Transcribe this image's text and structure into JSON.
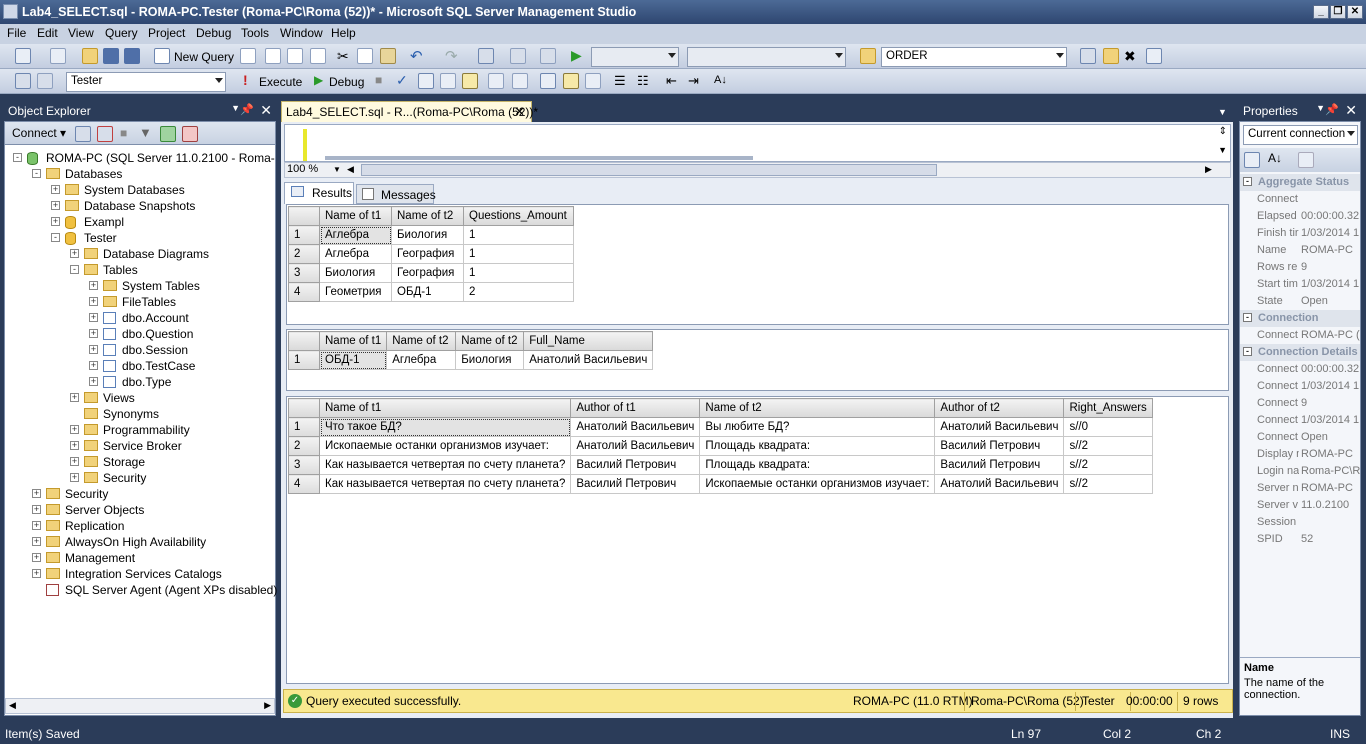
{
  "window": {
    "title": "Lab4_SELECT.sql - ROMA-PC.Tester (Roma-PC\\Roma (52))* - Microsoft SQL Server Management Studio"
  },
  "menu": [
    "File",
    "Edit",
    "View",
    "Query",
    "Project",
    "Debug",
    "Tools",
    "Window",
    "Help"
  ],
  "toolbar1": {
    "new_query": "New Query",
    "search_value": "ORDER"
  },
  "toolbar2": {
    "database": "Tester",
    "execute": "Execute",
    "debug": "Debug"
  },
  "object_explorer": {
    "title": "Object Explorer",
    "connect": "Connect",
    "tree": [
      {
        "label": "ROMA-PC (SQL Server 11.0.2100 - Roma-PC\\Roma)",
        "level": 0,
        "exp": "-",
        "icon": "server-icon"
      },
      {
        "label": "Databases",
        "level": 1,
        "exp": "-",
        "icon": "folder-icon"
      },
      {
        "label": "System Databases",
        "level": 2,
        "exp": "+",
        "icon": "folder-icon"
      },
      {
        "label": "Database Snapshots",
        "level": 2,
        "exp": "+",
        "icon": "folder-icon"
      },
      {
        "label": "Exampl",
        "level": 2,
        "exp": "+",
        "icon": "database-icon"
      },
      {
        "label": "Tester",
        "level": 2,
        "exp": "-",
        "icon": "database-icon"
      },
      {
        "label": "Database Diagrams",
        "level": 3,
        "exp": "+",
        "icon": "folder-icon"
      },
      {
        "label": "Tables",
        "level": 3,
        "exp": "-",
        "icon": "folder-icon"
      },
      {
        "label": "System Tables",
        "level": 4,
        "exp": "+",
        "icon": "folder-icon"
      },
      {
        "label": "FileTables",
        "level": 4,
        "exp": "+",
        "icon": "folder-icon"
      },
      {
        "label": "dbo.Account",
        "level": 4,
        "exp": "+",
        "icon": "table-icon"
      },
      {
        "label": "dbo.Question",
        "level": 4,
        "exp": "+",
        "icon": "table-icon"
      },
      {
        "label": "dbo.Session",
        "level": 4,
        "exp": "+",
        "icon": "table-icon"
      },
      {
        "label": "dbo.TestCase",
        "level": 4,
        "exp": "+",
        "icon": "table-icon"
      },
      {
        "label": "dbo.Type",
        "level": 4,
        "exp": "+",
        "icon": "table-icon"
      },
      {
        "label": "Views",
        "level": 3,
        "exp": "+",
        "icon": "folder-icon"
      },
      {
        "label": "Synonyms",
        "level": 3,
        "exp": "",
        "icon": "folder-icon"
      },
      {
        "label": "Programmability",
        "level": 3,
        "exp": "+",
        "icon": "folder-icon"
      },
      {
        "label": "Service Broker",
        "level": 3,
        "exp": "+",
        "icon": "folder-icon"
      },
      {
        "label": "Storage",
        "level": 3,
        "exp": "+",
        "icon": "folder-icon"
      },
      {
        "label": "Security",
        "level": 3,
        "exp": "+",
        "icon": "folder-icon"
      },
      {
        "label": "Security",
        "level": 1,
        "exp": "+",
        "icon": "folder-icon"
      },
      {
        "label": "Server Objects",
        "level": 1,
        "exp": "+",
        "icon": "folder-icon"
      },
      {
        "label": "Replication",
        "level": 1,
        "exp": "+",
        "icon": "folder-icon"
      },
      {
        "label": "AlwaysOn High Availability",
        "level": 1,
        "exp": "+",
        "icon": "folder-icon"
      },
      {
        "label": "Management",
        "level": 1,
        "exp": "+",
        "icon": "folder-icon"
      },
      {
        "label": "Integration Services Catalogs",
        "level": 1,
        "exp": "+",
        "icon": "folder-icon"
      },
      {
        "label": "SQL Server Agent (Agent XPs disabled)",
        "level": 1,
        "exp": "",
        "icon": "agent-icon"
      }
    ]
  },
  "document": {
    "tab": "Lab4_SELECT.sql - R...(Roma-PC\\Roma (52))*",
    "zoom": "100 %",
    "results_tab": "Results",
    "messages_tab": "Messages"
  },
  "grid1": {
    "columns": [
      "Name of t1",
      "Name of t2",
      "Questions_Amount"
    ],
    "rows": [
      [
        "1",
        "Аглебра",
        "Биология",
        "1"
      ],
      [
        "2",
        "Аглебра",
        "География",
        "1"
      ],
      [
        "3",
        "Биология",
        "География",
        "1"
      ],
      [
        "4",
        "Геометрия",
        "ОБД-1",
        "2"
      ]
    ]
  },
  "grid2": {
    "columns": [
      "Name of t1",
      "Name of t2",
      "Name of t2",
      "Full_Name"
    ],
    "rows": [
      [
        "1",
        "ОБД-1",
        "Аглебра",
        "Биология",
        "Анатолий Васильевич"
      ]
    ]
  },
  "grid3": {
    "columns": [
      "Name of t1",
      "Author of t1",
      "Name of t2",
      "Author of t2",
      "Right_Answers"
    ],
    "rows": [
      [
        "1",
        "Что такое БД?",
        "Анатолий Васильевич",
        "Вы любите БД?",
        "Анатолий Васильевич",
        "s//0"
      ],
      [
        "2",
        "Ископаемые останки организмов изучает:",
        "Анатолий Васильевич",
        "Площадь квадрата:",
        "Василий Петрович",
        "s//2"
      ],
      [
        "3",
        "Как называется четвертая по счету планета?",
        "Василий Петрович",
        "Площадь квадрата:",
        "Василий Петрович",
        "s//2"
      ],
      [
        "4",
        "Как называется четвертая по счету планета?",
        "Василий Петрович",
        "Ископаемые останки организмов изучает:",
        "Анатолий Васильевич",
        "s//2"
      ]
    ]
  },
  "query_status": {
    "message": "Query executed successfully.",
    "server": "ROMA-PC (11.0 RTM)",
    "user": "Roma-PC\\Roma (52)",
    "database": "Tester",
    "time": "00:00:00",
    "rows": "9 rows"
  },
  "properties": {
    "title": "Properties",
    "selector": "Current connection",
    "categories": [
      {
        "name": "Aggregate Status",
        "rows": [
          [
            "Connect",
            ""
          ],
          [
            "Elapsed",
            "00:00:00.32"
          ],
          [
            "Finish tir",
            "1/03/2014 1"
          ],
          [
            "Name",
            "ROMA-PC"
          ],
          [
            "Rows re",
            "9"
          ],
          [
            "Start tim",
            "1/03/2014 1"
          ],
          [
            "State",
            "Open"
          ]
        ]
      },
      {
        "name": "Connection",
        "rows": [
          [
            "Connect",
            "ROMA-PC (R"
          ]
        ]
      },
      {
        "name": "Connection Details",
        "rows": [
          [
            "Connect",
            "00:00:00.32"
          ],
          [
            "Connect",
            "1/03/2014 1"
          ],
          [
            "Connect",
            "9"
          ],
          [
            "Connect",
            "1/03/2014 1"
          ],
          [
            "Connect",
            "Open"
          ],
          [
            "Display n",
            "ROMA-PC"
          ],
          [
            "Login na",
            "Roma-PC\\Ro"
          ],
          [
            "Server n",
            "ROMA-PC"
          ],
          [
            "Server v",
            "11.0.2100"
          ],
          [
            "Session",
            ""
          ],
          [
            "SPID",
            "52"
          ]
        ]
      }
    ],
    "desc_title": "Name",
    "desc_text": "The name of the connection."
  },
  "statusbar": {
    "left": "Item(s) Saved",
    "ln": "Ln 97",
    "col": "Col 2",
    "ch": "Ch 2",
    "ins": "INS"
  },
  "colors": {
    "chrome": "#2b3c59",
    "status_yellow": "#f9e88f",
    "tab_yellow": "#fffadf"
  }
}
